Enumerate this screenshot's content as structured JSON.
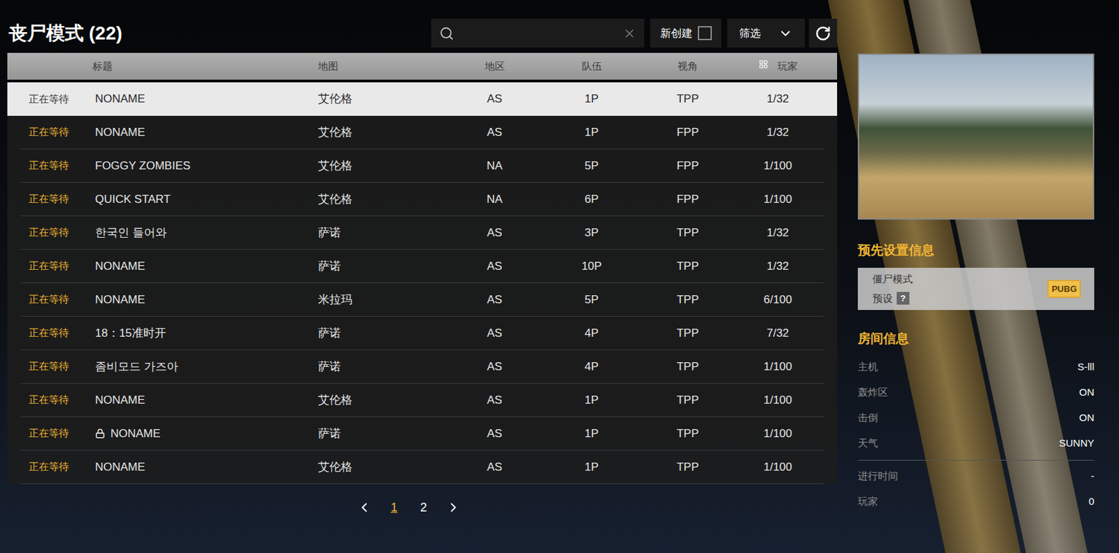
{
  "page": {
    "title": "丧尸模式 (22)"
  },
  "search": {
    "placeholder": "",
    "clear_icon": true
  },
  "new_created": {
    "label": "新创建",
    "checked": false
  },
  "filter": {
    "label": "筛选"
  },
  "table": {
    "columns": [
      "标题",
      "地图",
      "地区",
      "队伍",
      "视角",
      "玩家"
    ],
    "rows": [
      {
        "status": "正在等待",
        "title": "NONAME",
        "locked": false,
        "map": "艾伦格",
        "region": "AS",
        "team": "1P",
        "view": "TPP",
        "players": "1/32",
        "selected": true
      },
      {
        "status": "正在等待",
        "title": "NONAME",
        "locked": false,
        "map": "艾伦格",
        "region": "AS",
        "team": "1P",
        "view": "FPP",
        "players": "1/32",
        "selected": false
      },
      {
        "status": "正在等待",
        "title": "FOGGY ZOMBIES",
        "locked": false,
        "map": "艾伦格",
        "region": "NA",
        "team": "5P",
        "view": "FPP",
        "players": "1/100",
        "selected": false
      },
      {
        "status": "正在等待",
        "title": "QUICK START",
        "locked": false,
        "map": "艾伦格",
        "region": "NA",
        "team": "6P",
        "view": "FPP",
        "players": "1/100",
        "selected": false
      },
      {
        "status": "正在等待",
        "title": "한국인 들어와",
        "locked": false,
        "map": "萨诺",
        "region": "AS",
        "team": "3P",
        "view": "TPP",
        "players": "1/32",
        "selected": false
      },
      {
        "status": "正在等待",
        "title": "NONAME",
        "locked": false,
        "map": "萨诺",
        "region": "AS",
        "team": "10P",
        "view": "TPP",
        "players": "1/32",
        "selected": false
      },
      {
        "status": "正在等待",
        "title": "NONAME",
        "locked": false,
        "map": "米拉玛",
        "region": "AS",
        "team": "5P",
        "view": "TPP",
        "players": "6/100",
        "selected": false
      },
      {
        "status": "正在等待",
        "title": "18：15准时开",
        "locked": false,
        "map": "萨诺",
        "region": "AS",
        "team": "4P",
        "view": "TPP",
        "players": "7/32",
        "selected": false
      },
      {
        "status": "正在等待",
        "title": "좀비모드 가즈아",
        "locked": false,
        "map": "萨诺",
        "region": "AS",
        "team": "4P",
        "view": "TPP",
        "players": "1/100",
        "selected": false
      },
      {
        "status": "正在等待",
        "title": "NONAME",
        "locked": false,
        "map": "艾伦格",
        "region": "AS",
        "team": "1P",
        "view": "TPP",
        "players": "1/100",
        "selected": false
      },
      {
        "status": "正在等待",
        "title": "NONAME",
        "locked": true,
        "map": "萨诺",
        "region": "AS",
        "team": "1P",
        "view": "TPP",
        "players": "1/100",
        "selected": false
      },
      {
        "status": "正在等待",
        "title": "NONAME",
        "locked": false,
        "map": "艾伦格",
        "region": "AS",
        "team": "1P",
        "view": "TPP",
        "players": "1/100",
        "selected": false
      }
    ]
  },
  "pagination": {
    "pages": [
      {
        "label": "1",
        "selected": true
      },
      {
        "label": "2",
        "selected": false
      }
    ]
  },
  "preset": {
    "title": "预先设置信息",
    "mode": "僵尸模式",
    "label": "预设",
    "help": "?",
    "logo": "PUBG"
  },
  "room_info": {
    "title": "房间信息",
    "settings": [
      {
        "label": "主机",
        "value": "S-lll"
      },
      {
        "label": "轰炸区",
        "value": "ON"
      },
      {
        "label": "击倒",
        "value": "ON"
      },
      {
        "label": "天气",
        "value": "SUNNY"
      }
    ],
    "status": [
      {
        "label": "进行时间",
        "value": "-"
      },
      {
        "label": "玩家",
        "value": "0"
      }
    ]
  }
}
